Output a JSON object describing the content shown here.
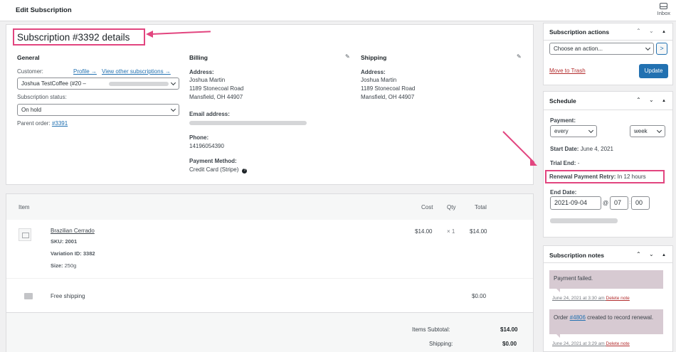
{
  "topbar": {
    "title": "Edit Subscription",
    "inbox_label": "Inbox"
  },
  "details": {
    "heading": "Subscription #3392 details",
    "general": {
      "title": "General",
      "customer_label": "Customer:",
      "profile_link": "Profile →",
      "other_subs_link": "View other subscriptions →",
      "customer_value": "Joshua TestCoffee (#20 –",
      "status_label": "Subscription status:",
      "status_value": "On hold",
      "parent_label": "Parent order:",
      "parent_link": "#3391"
    },
    "billing": {
      "title": "Billing",
      "address_label": "Address:",
      "address_lines": [
        "Joshua Martin",
        "1189 Stonecoal Road",
        "Mansfield, OH 44907"
      ],
      "email_label": "Email address:",
      "phone_label": "Phone:",
      "phone_value": "14196054390",
      "payment_label": "Payment Method:",
      "payment_value": "Credit Card (Stripe)"
    },
    "shipping": {
      "title": "Shipping",
      "address_label": "Address:",
      "address_lines": [
        "Joshua Martin",
        "1189 Stonecoal Road",
        "Mansfield, OH 44907"
      ]
    }
  },
  "items": {
    "headers": {
      "item": "Item",
      "cost": "Cost",
      "qty": "Qty",
      "total": "Total"
    },
    "product": {
      "name": "Brazilian Cerrado",
      "sku_label": "SKU:",
      "sku": "2001",
      "variation_label": "Variation ID:",
      "variation": "3382",
      "size_label": "Size:",
      "size": "250g",
      "cost": "$14.00",
      "qty": "× 1",
      "total": "$14.00"
    },
    "shipping_line": {
      "name": "Free shipping",
      "total": "$0.00"
    },
    "totals": {
      "subtotal_label": "Items Subtotal:",
      "subtotal": "$14.00",
      "shipping_label": "Shipping:",
      "shipping": "$0.00"
    }
  },
  "actions": {
    "title": "Subscription actions",
    "select_value": "Choose an action...",
    "go_label": ">",
    "trash_link": "Move to Trash",
    "update_label": "Update"
  },
  "schedule": {
    "title": "Schedule",
    "payment_label": "Payment:",
    "interval_value": "every",
    "period_value": "week",
    "start_label": "Start Date:",
    "start_value": "June 4, 2021",
    "trial_label": "Trial End:",
    "trial_value": "-",
    "retry_label": "Renewal Payment Retry:",
    "retry_value": "In 12 hours",
    "end_label": "End Date:",
    "end_date": "2021-09-04",
    "at_symbol": "@",
    "end_hour": "07",
    "end_minute": "00"
  },
  "notes": {
    "title": "Subscription notes",
    "items": [
      {
        "text": "Payment failed.",
        "meta": "June 24, 2021 at 3:30 am",
        "delete": "Delete note"
      },
      {
        "text_before": "Order ",
        "link": "#4806",
        "text_after": " created to record renewal.",
        "meta": "June 24, 2021 at 3:29 am",
        "delete": "Delete note"
      }
    ]
  },
  "colors": {
    "accent": "#2271b1",
    "highlight": "#e2457f",
    "note_bg": "#d7cad2",
    "danger": "#b32d2e"
  },
  "icons": [
    "inbox-icon",
    "pencil-icon",
    "help-icon",
    "chevron-up-icon",
    "chevron-down-icon",
    "triangle-up-icon",
    "product-placeholder-icon",
    "shipping-icon"
  ]
}
